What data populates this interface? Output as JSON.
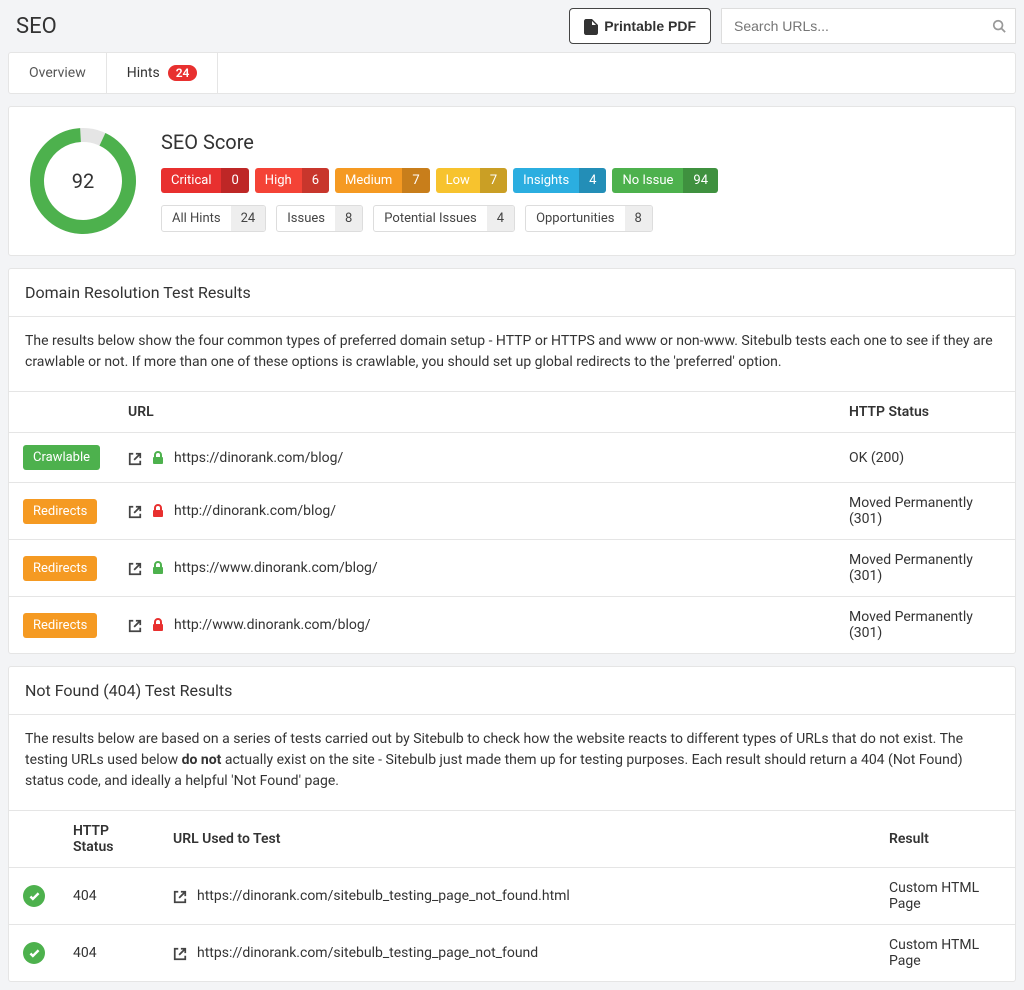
{
  "header": {
    "title": "SEO",
    "pdf_button": "Printable PDF",
    "search_placeholder": "Search URLs..."
  },
  "tabs": {
    "overview": "Overview",
    "hints": "Hints",
    "hints_count": "24"
  },
  "score": {
    "value": "92",
    "title": "SEO Score",
    "ring_fill_pct": 92
  },
  "severity": {
    "critical": {
      "label": "Critical",
      "count": "0"
    },
    "high": {
      "label": "High",
      "count": "6"
    },
    "medium": {
      "label": "Medium",
      "count": "7"
    },
    "low": {
      "label": "Low",
      "count": "7"
    },
    "insights": {
      "label": "Insights",
      "count": "4"
    },
    "noissue": {
      "label": "No Issue",
      "count": "94"
    }
  },
  "filters": {
    "all": {
      "label": "All Hints",
      "count": "24"
    },
    "issues": {
      "label": "Issues",
      "count": "8"
    },
    "potential": {
      "label": "Potential Issues",
      "count": "4"
    },
    "opportunities": {
      "label": "Opportunities",
      "count": "8"
    }
  },
  "domain_section": {
    "heading": "Domain Resolution Test Results",
    "desc": "The results below show the four common types of preferred domain setup - HTTP or HTTPS and www or non-www. Sitebulb tests each one to see if they are crawlable or not. If more than one of these options is crawlable, you should set up global redirects to the 'preferred' option.",
    "col_url": "URL",
    "col_status": "HTTP Status",
    "rows": [
      {
        "status": "Crawlable",
        "status_type": "green",
        "secure": true,
        "url": "https://dinorank.com/blog/",
        "http": "OK (200)"
      },
      {
        "status": "Redirects",
        "status_type": "orange",
        "secure": false,
        "url": "http://dinorank.com/blog/",
        "http": "Moved Permanently (301)"
      },
      {
        "status": "Redirects",
        "status_type": "orange",
        "secure": true,
        "url": "https://www.dinorank.com/blog/",
        "http": "Moved Permanently (301)"
      },
      {
        "status": "Redirects",
        "status_type": "orange",
        "secure": false,
        "url": "http://www.dinorank.com/blog/",
        "http": "Moved Permanently (301)"
      }
    ]
  },
  "nf_section": {
    "heading": "Not Found (404) Test Results",
    "desc_pre": "The results below are based on a series of tests carried out by Sitebulb to check how the website reacts to different types of URLs that do not exist. The testing URLs used below ",
    "desc_bold": "do not",
    "desc_post": " actually exist on the site - Sitebulb just made them up for testing purposes. Each result should return a 404 (Not Found) status code, and ideally a helpful 'Not Found' page.",
    "col_httpstatus": "HTTP Status",
    "col_url": "URL Used to Test",
    "col_result": "Result",
    "rows": [
      {
        "code": "404",
        "url": "https://dinorank.com/sitebulb_testing_page_not_found.html",
        "result": "Custom HTML Page"
      },
      {
        "code": "404",
        "url": "https://dinorank.com/sitebulb_testing_page_not_found",
        "result": "Custom HTML Page"
      }
    ]
  }
}
